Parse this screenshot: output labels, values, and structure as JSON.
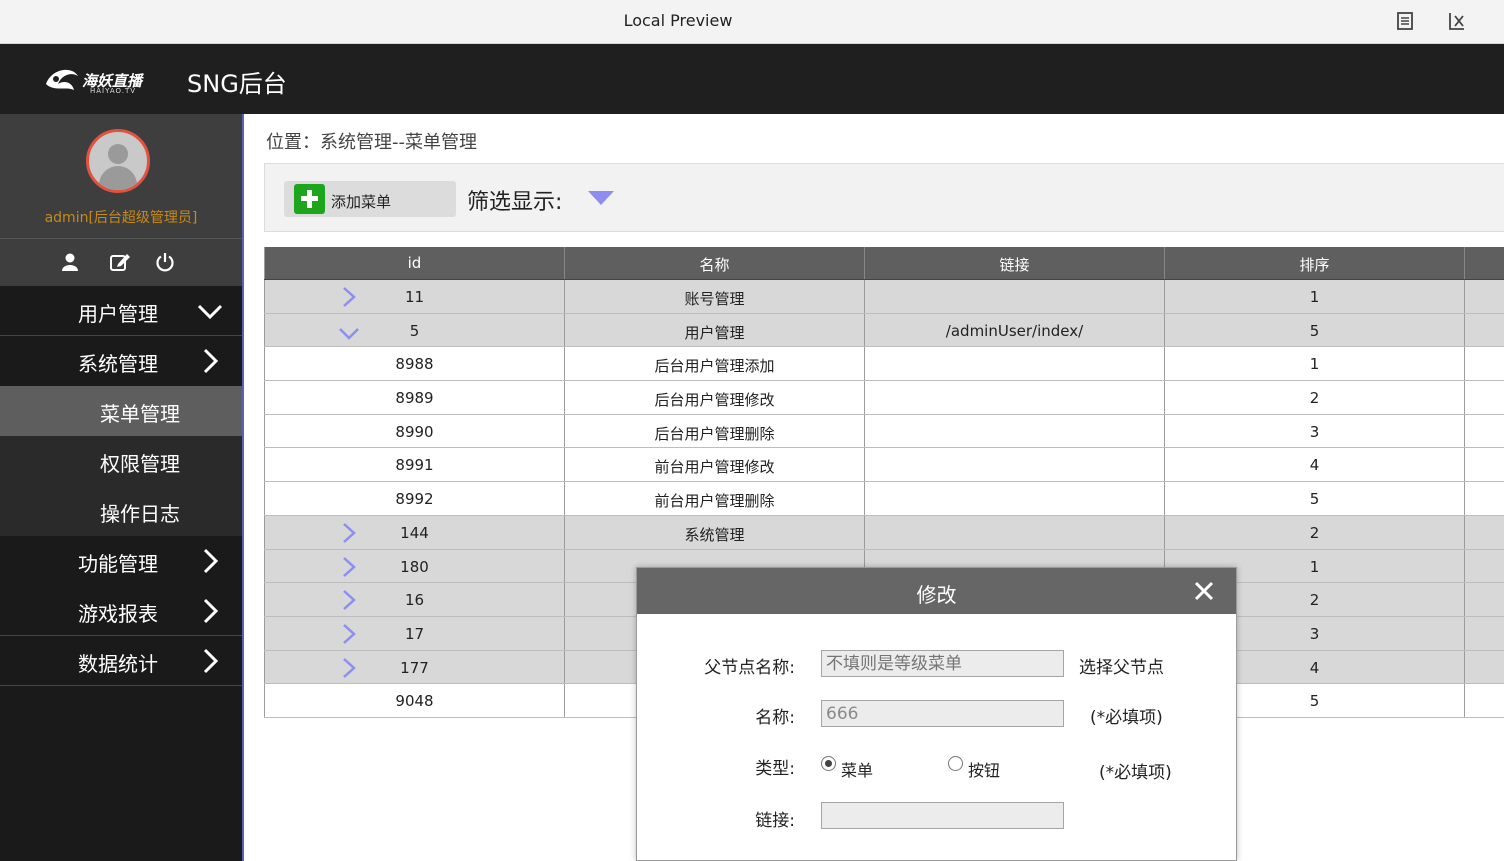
{
  "window": {
    "title": "Local Preview"
  },
  "header": {
    "logo_text": "海妖直播",
    "logo_sub": "HAIYAO.TV",
    "app_title": "SNG后台"
  },
  "user": {
    "name": "admin[后台超级管理员]"
  },
  "sidebar": {
    "items": [
      {
        "label": "用户管理",
        "state": "expanded"
      },
      {
        "label": "系统管理",
        "state": "collapsed"
      },
      {
        "label": "菜单管理",
        "sub": true,
        "active": true
      },
      {
        "label": "权限管理",
        "sub": true
      },
      {
        "label": "操作日志",
        "sub": true
      },
      {
        "label": "功能管理",
        "state": "collapsed"
      },
      {
        "label": "游戏报表",
        "state": "collapsed"
      },
      {
        "label": "数据统计",
        "state": "collapsed"
      }
    ]
  },
  "breadcrumb": "位置：系统管理--菜单管理",
  "toolbar": {
    "add_label": "添加菜单",
    "filter_label": "筛选显示:"
  },
  "table": {
    "columns": [
      "id",
      "名称",
      "链接",
      "排序"
    ],
    "rows": [
      {
        "id": "11",
        "name": "账号管理",
        "link": "",
        "order": "1",
        "kind": "parent",
        "toggle": "collapsed"
      },
      {
        "id": "5",
        "name": "用户管理",
        "link": "/adminUser/index/",
        "order": "5",
        "kind": "parent",
        "toggle": "expanded"
      },
      {
        "id": "8988",
        "name": "后台用户管理添加",
        "link": "",
        "order": "1",
        "kind": "child"
      },
      {
        "id": "8989",
        "name": "后台用户管理修改",
        "link": "",
        "order": "2",
        "kind": "child"
      },
      {
        "id": "8990",
        "name": "后台用户管理删除",
        "link": "",
        "order": "3",
        "kind": "child"
      },
      {
        "id": "8991",
        "name": "前台用户管理修改",
        "link": "",
        "order": "4",
        "kind": "child"
      },
      {
        "id": "8992",
        "name": "前台用户管理删除",
        "link": "",
        "order": "5",
        "kind": "child"
      },
      {
        "id": "144",
        "name": "系统管理",
        "link": "",
        "order": "2",
        "kind": "parent",
        "toggle": "collapsed"
      },
      {
        "id": "180",
        "name": "",
        "link": "",
        "order": "1",
        "kind": "parent",
        "toggle": "collapsed"
      },
      {
        "id": "16",
        "name": "",
        "link": "",
        "order": "2",
        "kind": "parent",
        "toggle": "collapsed"
      },
      {
        "id": "17",
        "name": "",
        "link": "",
        "order": "3",
        "kind": "parent",
        "toggle": "collapsed"
      },
      {
        "id": "177",
        "name": "",
        "link": "",
        "order": "4",
        "kind": "parent",
        "toggle": "collapsed"
      },
      {
        "id": "9048",
        "name": "",
        "link": "",
        "order": "5",
        "kind": "child"
      }
    ]
  },
  "modal": {
    "title": "修改",
    "parent_label": "父节点名称:",
    "parent_placeholder": "不填则是等级菜单",
    "parent_action": "选择父节点",
    "name_label": "名称:",
    "name_value": "666",
    "name_note": "(*必填项)",
    "type_label": "类型:",
    "type_options": [
      "菜单",
      "按钮"
    ],
    "type_selected": "菜单",
    "type_note": "(*必填项)",
    "link_label": "链接:",
    "link_value": ""
  },
  "colors": {
    "header_bg": "#1f1f1f",
    "sidebar_bg": "#1a1a1a",
    "accent_chevron": "#8e8ef0",
    "add_green": "#1da51d",
    "username": "#c78a18"
  }
}
